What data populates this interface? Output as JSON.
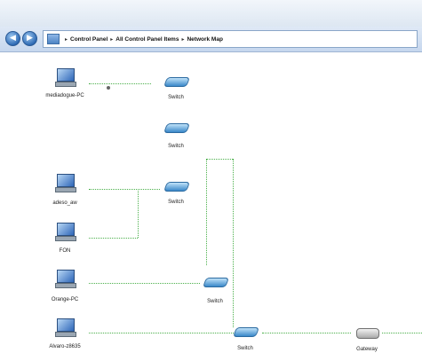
{
  "address_bar": {
    "breadcrumbs": [
      "Control Panel",
      "All Control Panel Items",
      "Network Map"
    ],
    "separator": "▸"
  },
  "nodes": {
    "pc1": "mediadogue-PC",
    "pc2": "adeso_aw",
    "pc3": "FON",
    "pc4": "Orange-PC",
    "pc5": "Alvaro-z8635",
    "sw1": "Switch",
    "sw2": "Switch",
    "sw3": "Switch",
    "sw4": "Switch",
    "sw5": "Switch",
    "gateway": "Gateway"
  },
  "colors": {
    "connection": "#4bb04b",
    "accent": "#2f6bb5"
  },
  "icons": {
    "back": "back-arrow-icon",
    "forward": "forward-arrow-icon",
    "computer": "computer-icon",
    "switch": "switch-icon",
    "gateway": "gateway-icon"
  }
}
